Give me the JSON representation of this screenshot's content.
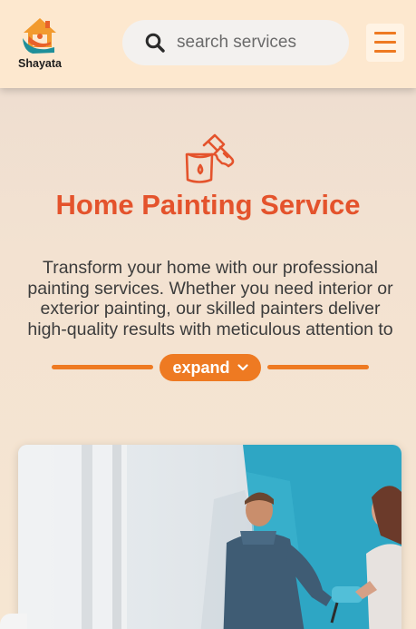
{
  "header": {
    "brand": "Shayata",
    "search_placeholder": "search services"
  },
  "hero": {
    "title": "Home Painting Service",
    "description": "Transform your home with our professional painting services. Whether you need interior or exterior painting, our skilled painters deliver high-quality results with meticulous attention to",
    "expand_label": "expand"
  },
  "colors": {
    "accent_orange": "#ee7a22",
    "title_red": "#e4532c",
    "header_bg": "#fde8cf"
  },
  "icons": {
    "menu": "hamburger-icon",
    "search": "magnifier-icon",
    "hero": "paint-bucket-brush-icon",
    "expand": "chevron-down-icon"
  }
}
